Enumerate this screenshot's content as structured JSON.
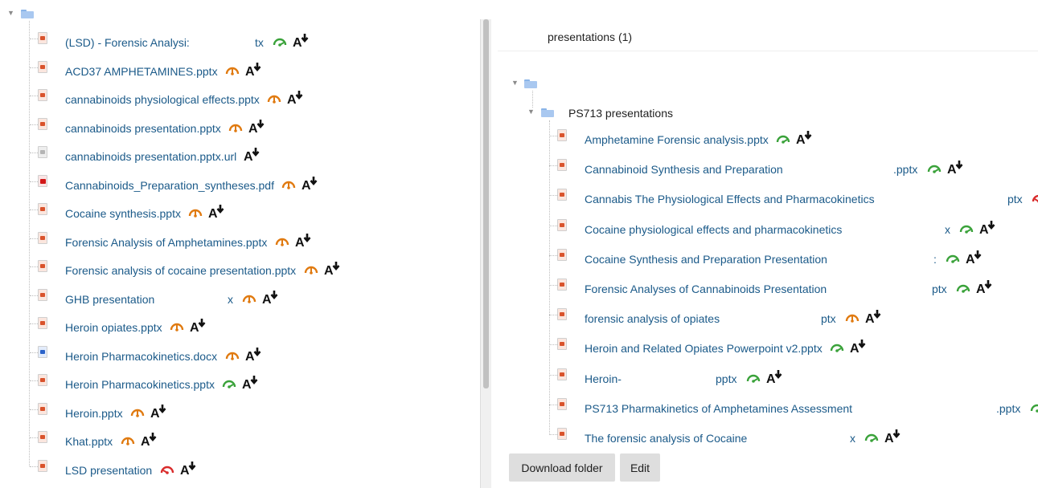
{
  "icons": {
    "expand": "tree-expanded-icon",
    "folder": "folder-icon",
    "file": "file-icon",
    "gauge": "gauge-icon",
    "accessibility": "accessibility-download-icon"
  },
  "colors": {
    "link": "#1b5a89",
    "gauge_green": "#3aa23a",
    "gauge_orange": "#e07a10",
    "gauge_red": "#d92b2b",
    "button_bg": "#dedede"
  },
  "left_tree": {
    "expand_glyph": "▼",
    "files": [
      {
        "name": "(LSD) - Forensic Analysi:",
        "ext": "tx",
        "gauge": "green",
        "type": "ppt"
      },
      {
        "name": "ACD37 AMPHETAMINES.pptx",
        "ext": "",
        "gauge": "orange",
        "type": "ppt"
      },
      {
        "name": "cannabinoids physiological effects.pptx",
        "ext": "",
        "gauge": "orange",
        "type": "ppt"
      },
      {
        "name": "cannabinoids presentation.pptx",
        "ext": "",
        "gauge": "orange",
        "type": "ppt"
      },
      {
        "name": "cannabinoids presentation.pptx.url",
        "ext": "",
        "gauge": "",
        "type": "url"
      },
      {
        "name": "Cannabinoids_Preparation_syntheses.pdf",
        "ext": "",
        "gauge": "orange",
        "type": "pdf"
      },
      {
        "name": "Cocaine synthesis.pptx",
        "ext": "",
        "gauge": "orange",
        "type": "ppt"
      },
      {
        "name": "Forensic Analysis of Amphetamines.pptx",
        "ext": "",
        "gauge": "orange",
        "type": "ppt"
      },
      {
        "name": "Forensic analysis of cocaine presentation.pptx",
        "ext": "",
        "gauge": "orange",
        "type": "ppt"
      },
      {
        "name": "GHB presentation",
        "ext": "x",
        "gauge": "orange",
        "type": "ppt"
      },
      {
        "name": "Heroin opiates.pptx",
        "ext": "",
        "gauge": "orange",
        "type": "ppt"
      },
      {
        "name": "Heroin Pharmacokinetics.docx",
        "ext": "",
        "gauge": "orange",
        "type": "doc"
      },
      {
        "name": "Heroin Pharmacokinetics.pptx",
        "ext": "",
        "gauge": "green",
        "type": "ppt"
      },
      {
        "name": "Heroin.pptx",
        "ext": "",
        "gauge": "orange",
        "type": "ppt"
      },
      {
        "name": "Khat.pptx",
        "ext": "",
        "gauge": "orange",
        "type": "ppt"
      },
      {
        "name": "LSD presentation",
        "ext": "",
        "gauge": "red",
        "type": "ppt"
      }
    ]
  },
  "right_pane": {
    "header": "presentations (1)",
    "expand_glyph": "▼",
    "subfolder": "PS713 presentations",
    "files": [
      {
        "name": "Amphetamine Forensic analysis.pptx",
        "ext": "",
        "gauge": "green",
        "type": "ppt"
      },
      {
        "name": "Cannabinoid Synthesis and Preparation",
        "ext": ".pptx",
        "gauge": "green",
        "type": "ppt"
      },
      {
        "name": "Cannabis The Physiological Effects and Pharmacokinetics",
        "ext": "ptx",
        "gauge": "red",
        "type": "ppt"
      },
      {
        "name": "Cocaine physiological effects and pharmacokinetics",
        "ext": "x",
        "gauge": "green",
        "type": "ppt"
      },
      {
        "name": "Cocaine Synthesis and Preparation Presentation",
        "ext": ":",
        "gauge": "green",
        "type": "ppt"
      },
      {
        "name": "Forensic Analyses of Cannabinoids Presentation",
        "ext": "ptx",
        "gauge": "green",
        "type": "ppt"
      },
      {
        "name": "forensic analysis of opiates",
        "ext": "ptx",
        "gauge": "orange",
        "type": "ppt"
      },
      {
        "name": "Heroin and Related Opiates Powerpoint v2.pptx",
        "ext": "",
        "gauge": "green",
        "type": "ppt"
      },
      {
        "name": "Heroin-",
        "ext": "pptx",
        "gauge": "green",
        "type": "ppt"
      },
      {
        "name": "PS713 Pharmakinetics of Amphetamines Assessment",
        "ext": ".pptx",
        "gauge": "green",
        "type": "ppt"
      },
      {
        "name": "The forensic analysis of Cocaine",
        "ext": "x",
        "gauge": "green",
        "type": "ppt"
      }
    ],
    "buttons": {
      "download": "Download folder",
      "edit": "Edit"
    }
  }
}
